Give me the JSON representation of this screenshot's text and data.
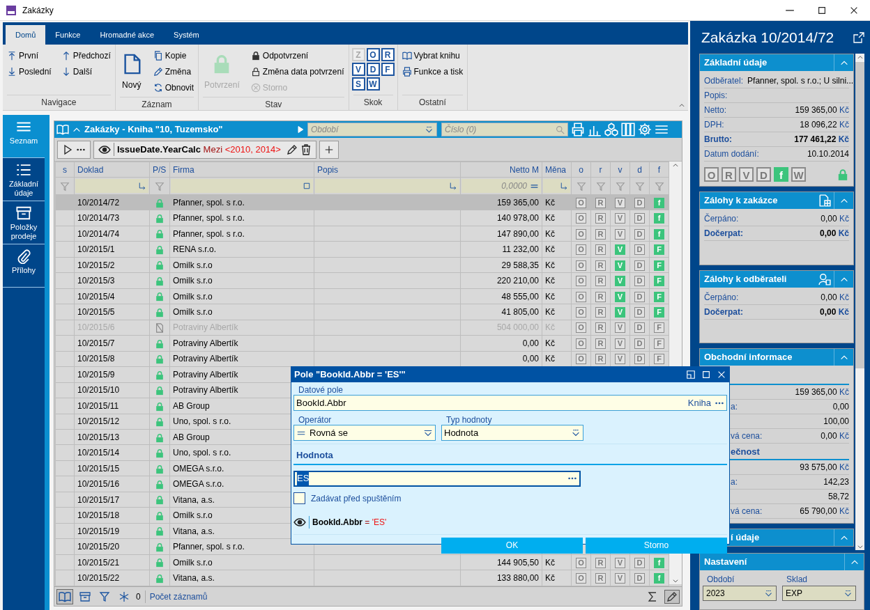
{
  "window": {
    "title": "Zakázky"
  },
  "ribbon": {
    "tabs": [
      {
        "label": "Domů",
        "selected": true
      },
      {
        "label": "Funkce",
        "selected": false
      },
      {
        "label": "Hromadné akce",
        "selected": false
      },
      {
        "label": "Systém",
        "selected": false
      }
    ],
    "groups": [
      {
        "label": "Navigace",
        "columns": [
          [
            {
              "label": "První",
              "kind": "small",
              "disabled": false
            },
            {
              "label": "Poslední",
              "kind": "small",
              "disabled": false
            }
          ],
          [
            {
              "label": "Předchozí",
              "kind": "small",
              "disabled": false
            },
            {
              "label": "Další",
              "kind": "small",
              "disabled": false
            }
          ]
        ]
      },
      {
        "label": "Záznam",
        "columns": [
          [
            {
              "label": "Nový",
              "kind": "large",
              "disabled": false
            }
          ],
          [
            {
              "label": "Kopie",
              "kind": "small",
              "disabled": false
            },
            {
              "label": "Změna",
              "kind": "small",
              "disabled": false
            },
            {
              "label": "Obnovit",
              "kind": "small",
              "disabled": false
            }
          ]
        ]
      },
      {
        "label": "Stav",
        "columns": [
          [
            {
              "label": "Potvrzení",
              "kind": "large",
              "disabled": true
            }
          ],
          [
            {
              "label": "Odpotvrzení",
              "kind": "small",
              "disabled": false
            },
            {
              "label": "Změna data potvrzení",
              "kind": "small",
              "disabled": false
            },
            {
              "label": "Storno",
              "kind": "small",
              "disabled": true
            }
          ]
        ]
      },
      {
        "label": "Skok",
        "columns": [
          [
            {
              "label": "Z",
              "kind": "key",
              "disabled": true
            },
            {
              "label": "V",
              "kind": "key",
              "disabled": false
            },
            {
              "label": "S",
              "kind": "key",
              "disabled": false
            }
          ],
          [
            {
              "label": "O",
              "kind": "key",
              "disabled": false
            },
            {
              "label": "D",
              "kind": "key",
              "disabled": false
            },
            {
              "label": "W",
              "kind": "key",
              "disabled": false
            }
          ],
          [
            {
              "label": "R",
              "kind": "key",
              "disabled": false
            },
            {
              "label": "F",
              "kind": "key",
              "disabled": false
            }
          ]
        ]
      },
      {
        "label": "Ostatní",
        "columns": [
          [
            {
              "label": "Vybrat knihu",
              "kind": "small",
              "disabled": false
            },
            {
              "label": "Funkce a tisk",
              "kind": "small",
              "disabled": false
            }
          ]
        ]
      }
    ]
  },
  "sidebar": {
    "items": [
      {
        "label": "Seznam",
        "selected": true
      },
      {
        "label": "Základní údaje",
        "selected": false
      },
      {
        "label": "Položky prodeje",
        "selected": false
      },
      {
        "label": "Přílohy",
        "selected": false
      }
    ]
  },
  "grid": {
    "title": "Zakázky - Kniha \"10, Tuzemsko\"",
    "period_placeholder": "Období",
    "number_placeholder": "Číslo (0)",
    "filter": {
      "field": "IssueDate.YearCalc",
      "operator": "Mezi",
      "value": "<2010, 2014>"
    },
    "columns": [
      "s",
      "Doklad",
      "P/S",
      "Firma",
      "Popis",
      "Netto M",
      "Měna",
      "o",
      "r",
      "v",
      "d",
      "f"
    ],
    "netto_filter_placeholder": "0,0000",
    "rows": [
      {
        "doklad": "10/2014/72",
        "kind": "lock",
        "firma": "Pfanner, spol. s r.o.",
        "netto": "159 365,00",
        "mena": "Kč",
        "selected": true,
        "disabled": false,
        "flags": [
          {
            "letter": "O",
            "on": false
          },
          {
            "letter": "R",
            "on": false
          },
          {
            "letter": "V",
            "on": false
          },
          {
            "letter": "D",
            "on": false
          },
          {
            "letter": "f",
            "on": true
          }
        ]
      },
      {
        "doklad": "10/2014/73",
        "kind": "lock",
        "firma": "Pfanner, spol. s r.o.",
        "netto": "140 978,00",
        "mena": "Kč",
        "selected": false,
        "disabled": false,
        "flags": [
          {
            "letter": "O",
            "on": false
          },
          {
            "letter": "R",
            "on": false
          },
          {
            "letter": "V",
            "on": false
          },
          {
            "letter": "D",
            "on": false
          },
          {
            "letter": "f",
            "on": true
          }
        ]
      },
      {
        "doklad": "10/2014/74",
        "kind": "lock",
        "firma": "Pfanner, spol. s r.o.",
        "netto": "147 890,00",
        "mena": "Kč",
        "selected": false,
        "disabled": false,
        "flags": [
          {
            "letter": "O",
            "on": false
          },
          {
            "letter": "R",
            "on": false
          },
          {
            "letter": "V",
            "on": false
          },
          {
            "letter": "D",
            "on": false
          },
          {
            "letter": "f",
            "on": true
          }
        ]
      },
      {
        "doklad": "10/2015/1",
        "kind": "lock",
        "firma": "RENA s.r.o.",
        "netto": "11 232,00",
        "mena": "Kč",
        "selected": false,
        "disabled": false,
        "flags": [
          {
            "letter": "O",
            "on": false
          },
          {
            "letter": "R",
            "on": false
          },
          {
            "letter": "V",
            "on": true
          },
          {
            "letter": "D",
            "on": false
          },
          {
            "letter": "F",
            "on": true
          }
        ]
      },
      {
        "doklad": "10/2015/2",
        "kind": "lock",
        "firma": "Omilk s.r.o",
        "netto": "29 588,35",
        "mena": "Kč",
        "selected": false,
        "disabled": false,
        "flags": [
          {
            "letter": "O",
            "on": false
          },
          {
            "letter": "R",
            "on": false
          },
          {
            "letter": "V",
            "on": true
          },
          {
            "letter": "D",
            "on": false
          },
          {
            "letter": "F",
            "on": true
          }
        ]
      },
      {
        "doklad": "10/2015/3",
        "kind": "lock",
        "firma": "Omilk s.r.o",
        "netto": "220 210,00",
        "mena": "Kč",
        "selected": false,
        "disabled": false,
        "flags": [
          {
            "letter": "O",
            "on": false
          },
          {
            "letter": "R",
            "on": false
          },
          {
            "letter": "V",
            "on": true
          },
          {
            "letter": "D",
            "on": false
          },
          {
            "letter": "F",
            "on": true
          }
        ]
      },
      {
        "doklad": "10/2015/4",
        "kind": "lock",
        "firma": "Omilk s.r.o",
        "netto": "48 555,00",
        "mena": "Kč",
        "selected": false,
        "disabled": false,
        "flags": [
          {
            "letter": "O",
            "on": false
          },
          {
            "letter": "R",
            "on": false
          },
          {
            "letter": "V",
            "on": true
          },
          {
            "letter": "D",
            "on": false
          },
          {
            "letter": "F",
            "on": true
          }
        ]
      },
      {
        "doklad": "10/2015/5",
        "kind": "lock",
        "firma": "Omilk s.r.o",
        "netto": "41 805,00",
        "mena": "Kč",
        "selected": false,
        "disabled": false,
        "flags": [
          {
            "letter": "O",
            "on": false
          },
          {
            "letter": "R",
            "on": false
          },
          {
            "letter": "V",
            "on": true
          },
          {
            "letter": "D",
            "on": false
          },
          {
            "letter": "F",
            "on": true
          }
        ]
      },
      {
        "doklad": "10/2015/6",
        "kind": "void",
        "firma": "Potraviny Albertík",
        "netto": "504 000,00",
        "mena": "Kč",
        "selected": false,
        "disabled": true,
        "flags": [
          {
            "letter": "O",
            "on": false
          },
          {
            "letter": "R",
            "on": false
          },
          {
            "letter": "V",
            "on": false
          },
          {
            "letter": "D",
            "on": false
          },
          {
            "letter": "F",
            "on": false
          }
        ]
      },
      {
        "doklad": "10/2015/7",
        "kind": "lock",
        "firma": "Potraviny Albertík",
        "netto": "0,00",
        "mena": "Kč",
        "selected": false,
        "disabled": false,
        "flags": [
          {
            "letter": "O",
            "on": false
          },
          {
            "letter": "R",
            "on": false
          },
          {
            "letter": "V",
            "on": false
          },
          {
            "letter": "D",
            "on": false
          },
          {
            "letter": "F",
            "on": false
          }
        ]
      },
      {
        "doklad": "10/2015/8",
        "kind": "lock",
        "firma": "Potraviny Albertík",
        "netto": "0,00",
        "mena": "Kč",
        "selected": false,
        "disabled": false,
        "flags": [
          {
            "letter": "O",
            "on": false
          },
          {
            "letter": "R",
            "on": false
          },
          {
            "letter": "V",
            "on": false
          },
          {
            "letter": "D",
            "on": false
          },
          {
            "letter": "F",
            "on": false
          }
        ]
      },
      {
        "doklad": "10/2015/9",
        "kind": "lock",
        "firma": "Potraviny Albertík",
        "selected": false,
        "disabled": false
      },
      {
        "doklad": "10/2015/10",
        "kind": "lock",
        "firma": "Potraviny Albertík",
        "selected": false,
        "disabled": false
      },
      {
        "doklad": "10/2015/11",
        "kind": "lock",
        "firma": "AB Group",
        "selected": false,
        "disabled": false
      },
      {
        "doklad": "10/2015/12",
        "kind": "lock",
        "firma": "Uno, spol. s r.o.",
        "selected": false,
        "disabled": false
      },
      {
        "doklad": "10/2015/13",
        "kind": "lock",
        "firma": "AB Group",
        "selected": false,
        "disabled": false
      },
      {
        "doklad": "10/2015/14",
        "kind": "lock",
        "firma": "Uno, spol. s r.o.",
        "selected": false,
        "disabled": false
      },
      {
        "doklad": "10/2015/15",
        "kind": "lock",
        "firma": "OMEGA s.r.o.",
        "selected": false,
        "disabled": false
      },
      {
        "doklad": "10/2015/16",
        "kind": "lock",
        "firma": "OMEGA s.r.o.",
        "selected": false,
        "disabled": false
      },
      {
        "doklad": "10/2015/17",
        "kind": "lock",
        "firma": "Vitana, a.s.",
        "selected": false,
        "disabled": false
      },
      {
        "doklad": "10/2015/18",
        "kind": "lock",
        "firma": "Omilk s.r.o",
        "selected": false,
        "disabled": false
      },
      {
        "doklad": "10/2015/19",
        "kind": "lock",
        "firma": "Vitana, a.s.",
        "selected": false,
        "disabled": false
      },
      {
        "doklad": "10/2015/20",
        "kind": "lock",
        "firma": "Pfanner, spol. s r.o.",
        "selected": false,
        "disabled": false
      },
      {
        "doklad": "10/2015/21",
        "kind": "lock",
        "firma": "Omilk s.r.o",
        "netto": "144 905,50",
        "mena": "Kč",
        "selected": false,
        "disabled": false,
        "flags": [
          {
            "letter": "O",
            "on": false
          },
          {
            "letter": "R",
            "on": false
          },
          {
            "letter": "V",
            "on": false
          },
          {
            "letter": "D",
            "on": false
          },
          {
            "letter": "f",
            "on": true
          }
        ]
      },
      {
        "doklad": "10/2015/22",
        "kind": "lock",
        "firma": "Vitana, a.s.",
        "netto": "133 880,00",
        "mena": "Kč",
        "selected": false,
        "disabled": false,
        "flags": [
          {
            "letter": "O",
            "on": false
          },
          {
            "letter": "R",
            "on": false
          },
          {
            "letter": "V",
            "on": false
          },
          {
            "letter": "D",
            "on": false
          },
          {
            "letter": "f",
            "on": true
          }
        ]
      }
    ],
    "status": {
      "count": "0",
      "label": "Počet záznamů"
    }
  },
  "detail": {
    "title": "Zakázka 10/2014/72",
    "sections": [
      {
        "title": "Základní údaje",
        "rows": [
          {
            "kind": "row",
            "label": "Odběratel:",
            "value": "Pfanner, spol. s r.o.; U silni...",
            "bold": false
          },
          {
            "kind": "row",
            "label": "Popis:",
            "bold": false
          },
          {
            "kind": "row",
            "label": "Netto:",
            "value": "159 365,00",
            "unit": "Kč",
            "bold": false
          },
          {
            "kind": "row",
            "label": "DPH:",
            "value": "18 096,22",
            "unit": "Kč",
            "bold": false
          },
          {
            "kind": "row",
            "label": "Brutto:",
            "value": "177 461,22",
            "unit": "Kč",
            "bold": true
          },
          {
            "kind": "row",
            "label": "Datum dodání:",
            "value": "10.10.2014",
            "bold": false
          }
        ],
        "flags": [
          {
            "letter": "O",
            "on": false
          },
          {
            "letter": "R",
            "on": false
          },
          {
            "letter": "V",
            "on": false
          },
          {
            "letter": "D",
            "on": false
          },
          {
            "letter": "f",
            "on": true
          },
          {
            "letter": "W",
            "on": false
          }
        ],
        "locked": true
      },
      {
        "title": "Zálohy k zakázce",
        "rows": [
          {
            "kind": "row",
            "label": "Čerpáno:",
            "value": "0,00",
            "unit": "Kč",
            "bold": false
          },
          {
            "kind": "row",
            "label": "Dočerpat:",
            "value": "0,00",
            "unit": "Kč",
            "bold": true
          }
        ]
      },
      {
        "title": "Zálohy k odběrateli",
        "rows": [
          {
            "kind": "row",
            "label": "Čerpáno:",
            "value": "0,00",
            "unit": "Kč",
            "bold": false
          },
          {
            "kind": "row",
            "label": "Dočerpat:",
            "value": "0,00",
            "unit": "Kč",
            "bold": true
          }
        ]
      },
      {
        "title": "Obchodní informace",
        "rows": [
          {
            "kind": "heading"
          },
          {
            "kind": "row",
            "value": "159 365,00",
            "unit": "Kč",
            "bold": false
          },
          {
            "kind": "row",
            "label": "a:",
            "value": "0,00",
            "bold": false
          },
          {
            "kind": "row",
            "value": "100,00",
            "bold": false
          },
          {
            "kind": "row",
            "label": "vá cena:",
            "value": "0,00",
            "unit": "Kč",
            "bold": false
          },
          {
            "kind": "heading",
            "label": "ečnost"
          },
          {
            "kind": "row",
            "value": "93 575,00",
            "unit": "Kč",
            "bold": false
          },
          {
            "kind": "row",
            "label": "a:",
            "value": "142,23",
            "bold": false
          },
          {
            "kind": "row",
            "value": "58,72",
            "bold": false
          },
          {
            "kind": "row",
            "label": "vá cena:",
            "value": "65 790,00",
            "unit": "Kč",
            "bold": false
          }
        ]
      },
      {
        "title": "í údaje"
      }
    ],
    "settings": {
      "title": "Nastavení",
      "fields": [
        {
          "label": "Období",
          "value": "2023"
        },
        {
          "label": "Sklad",
          "value": "EXP"
        }
      ]
    }
  },
  "dialog": {
    "title": "Pole \"BookId.Abbr = 'ES'\"",
    "data_field": {
      "label": "Datové pole",
      "value": "BookId.Abbr",
      "hint": "Kniha"
    },
    "operator": {
      "label": "Operátor",
      "value": "Rovná se"
    },
    "value_type": {
      "label": "Typ hodnoty",
      "value": "Hodnota"
    },
    "value_heading": "Hodnota",
    "value": "ES",
    "ask_before_run": {
      "label": "Zadávat před spuštěním",
      "checked": false
    },
    "preview": {
      "field": "BookId.Abbr",
      "operator": "=",
      "value": "'ES'"
    },
    "buttons": [
      "OK",
      "Storno"
    ]
  }
}
